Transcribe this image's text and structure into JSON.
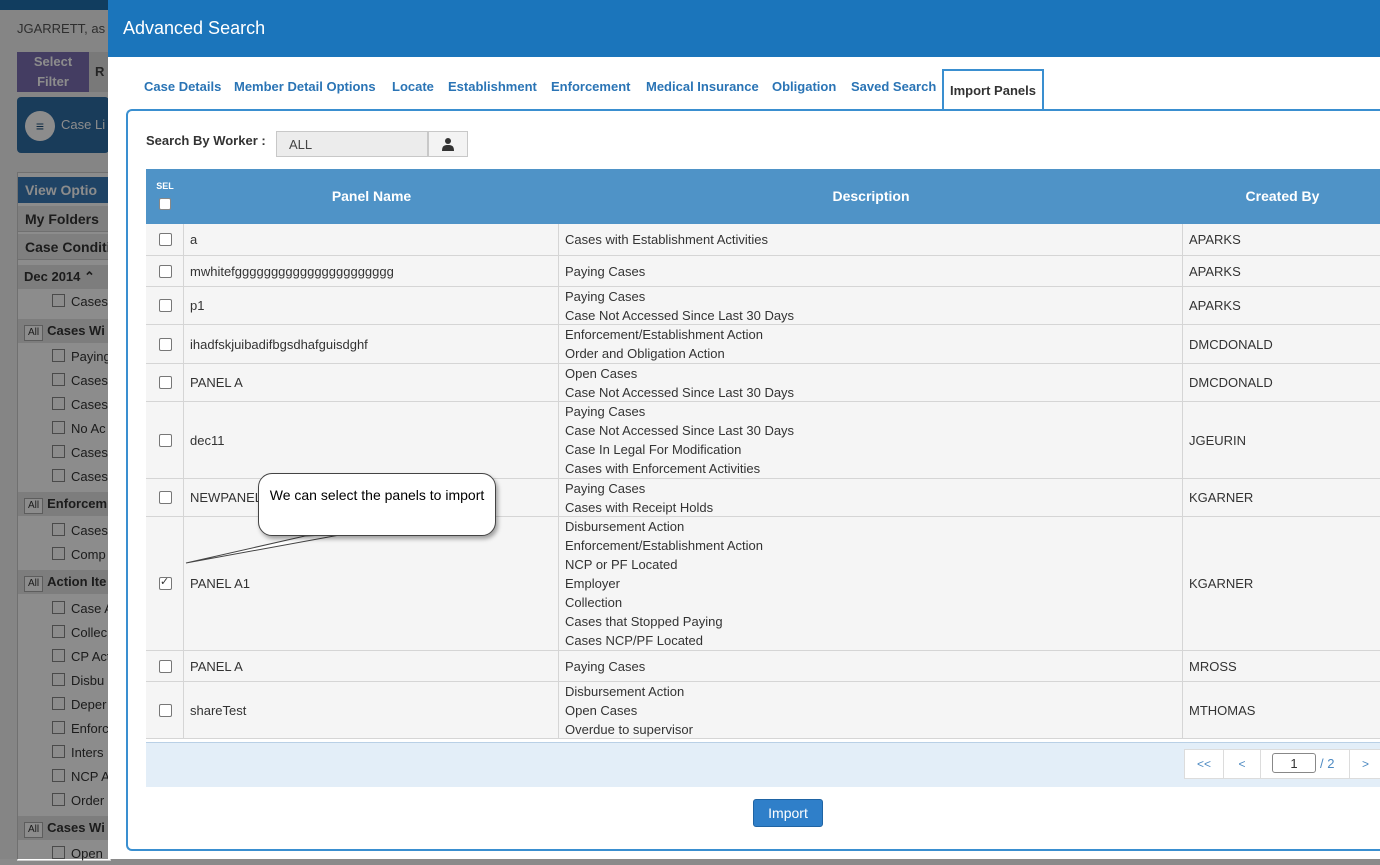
{
  "background": {
    "user_text": "JGARRETT, as",
    "select_filter": "Select Filter",
    "tab_r": "R",
    "case_list": "Case Li",
    "view_options": "View Optio",
    "my_folders": "My Folders",
    "case_conditions": "Case Conditi",
    "dec_2014": "Dec 2014",
    "group_all": "All",
    "items": {
      "cases_1": "Cases",
      "cases_wi": "Cases Wi",
      "paying": "Paying",
      "cases_2": "Cases",
      "cases_3": "Cases",
      "no_ac": "No Ac",
      "cases_4": "Cases",
      "cases_5": "Cases",
      "enforcem": "Enforcem",
      "cases_6": "Cases",
      "comp": "Comp",
      "action_ite": "Action Ite",
      "case_a": "Case A",
      "collec": "Collec",
      "cp_act": "CP Act",
      "disbu": "Disbu",
      "deper": "Deper",
      "enforc": "Enforc",
      "inters": "Inters",
      "ncp_a": "NCP A",
      "order": "Order",
      "cases_wi_2": "Cases Wi",
      "open": "Open"
    }
  },
  "modal": {
    "title": "Advanced Search",
    "tabs": [
      "Case Details",
      "Member Detail Options",
      "Locate",
      "Establishment",
      "Enforcement",
      "Medical Insurance",
      "Obligation",
      "Saved Search",
      "Import Panels"
    ],
    "search_by_worker_label": "Search By Worker :",
    "worker_value": "ALL",
    "table": {
      "sel_header": "SEL",
      "columns": [
        "Panel Name",
        "Description",
        "Created By"
      ],
      "rows": [
        {
          "name": "a",
          "desc": [
            "Cases with Establishment Activities"
          ],
          "by": "APARKS",
          "checked": false
        },
        {
          "name": "mwhitefgggggggggggggggggggggg",
          "desc": [
            "Paying Cases"
          ],
          "by": "APARKS",
          "checked": false
        },
        {
          "name": "p1",
          "desc": [
            "Paying Cases",
            "Case Not Accessed Since Last 30 Days"
          ],
          "by": "APARKS",
          "checked": false
        },
        {
          "name": "ihadfskjuibadifbgsdhafguisdghf",
          "desc": [
            "Enforcement/Establishment Action",
            "Order and Obligation Action"
          ],
          "by": "DMCDONALD",
          "checked": false
        },
        {
          "name": "PANEL A",
          "desc": [
            "Open Cases",
            "Case Not Accessed Since Last 30 Days"
          ],
          "by": "DMCDONALD",
          "checked": false
        },
        {
          "name": "dec11",
          "desc": [
            "Paying Cases",
            "Case Not Accessed Since Last 30 Days",
            "Case In Legal For Modification",
            "Cases with Enforcement Activities"
          ],
          "by": "JGEURIN",
          "checked": false
        },
        {
          "name": "NEWPANEL",
          "desc": [
            "Paying Cases",
            "Cases with Receipt Holds"
          ],
          "by": "KGARNER",
          "checked": false
        },
        {
          "name": "PANEL A1",
          "desc": [
            "Disbursement Action",
            "Enforcement/Establishment Action",
            "NCP or PF Located",
            "Employer",
            "Collection",
            "Cases that Stopped Paying",
            "Cases NCP/PF Located"
          ],
          "by": "KGARNER",
          "checked": true
        },
        {
          "name": "PANEL A",
          "desc": [
            "Paying Cases"
          ],
          "by": "MROSS",
          "checked": false
        },
        {
          "name": "shareTest",
          "desc": [
            "Disbursement Action",
            "Open Cases",
            "Overdue to supervisor"
          ],
          "by": "MTHOMAS",
          "checked": false
        }
      ]
    },
    "pager": {
      "first": "<<",
      "prev": "<",
      "current_page": "1",
      "total": "/ 2",
      "next": ">"
    },
    "import_button": "Import"
  },
  "callout": {
    "text": "We can select the panels to import"
  },
  "colors": {
    "header_blue": "#1b75bb",
    "grid_header": "#4f93c7",
    "tab_link": "#2a74b5",
    "button": "#2f7fc9"
  },
  "icons": {
    "worker_lookup": "person-icon",
    "case_list": "list-icon"
  }
}
